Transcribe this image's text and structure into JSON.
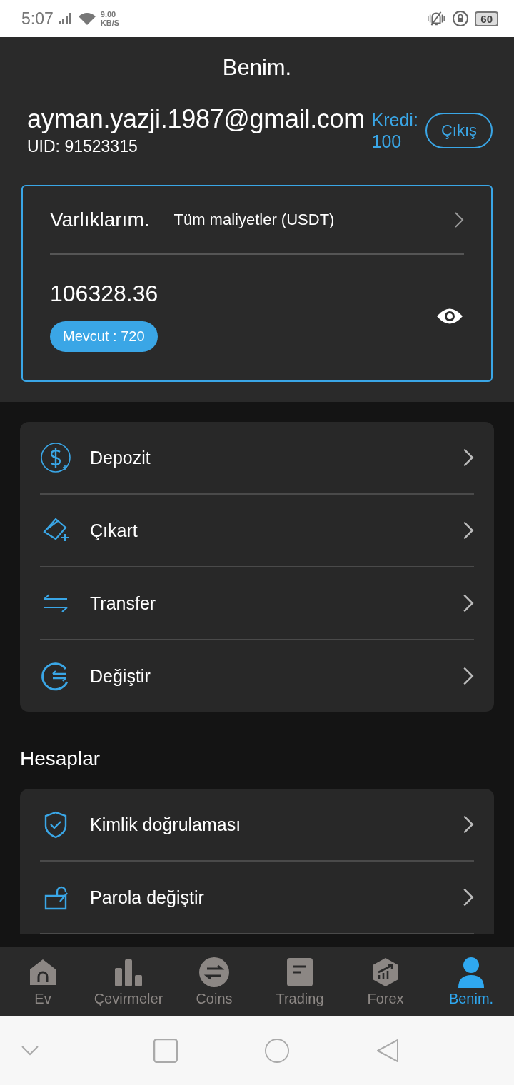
{
  "status_bar": {
    "time": "5:07",
    "speed": "9.00",
    "speed_unit": "KB/S",
    "battery": "60"
  },
  "header": {
    "title": "Benim."
  },
  "account": {
    "email": "ayman.yazji.1987@gmail.com",
    "uid": "UID: 91523315",
    "credit_label": "Kredi:",
    "credit_value": "100",
    "logout": "Çıkış"
  },
  "assets": {
    "title": "Varlıklarım.",
    "subtitle": "Tüm maliyetler (USDT)",
    "total": "106328.36",
    "available": "Mevcut : 720"
  },
  "actions": [
    {
      "kind": "deposit",
      "label": "Depozit"
    },
    {
      "kind": "withdraw",
      "label": "Çıkart"
    },
    {
      "kind": "transfer",
      "label": "Transfer"
    },
    {
      "kind": "exchange",
      "label": "Değiştir"
    }
  ],
  "accounts": {
    "title": "Hesaplar",
    "items": [
      {
        "kind": "verify",
        "label": "Kimlik doğrulaması"
      },
      {
        "kind": "password",
        "label": "Parola değiştir"
      }
    ]
  },
  "tabs": [
    {
      "kind": "home",
      "label": "Ev",
      "selected": false
    },
    {
      "kind": "bars",
      "label": "Çevirmeler",
      "selected": false
    },
    {
      "kind": "swap",
      "label": "Coins",
      "selected": false
    },
    {
      "kind": "doc",
      "label": "Trading",
      "selected": false
    },
    {
      "kind": "hex",
      "label": "Forex",
      "selected": false
    },
    {
      "kind": "person",
      "label": "Benim.",
      "selected": true
    }
  ]
}
